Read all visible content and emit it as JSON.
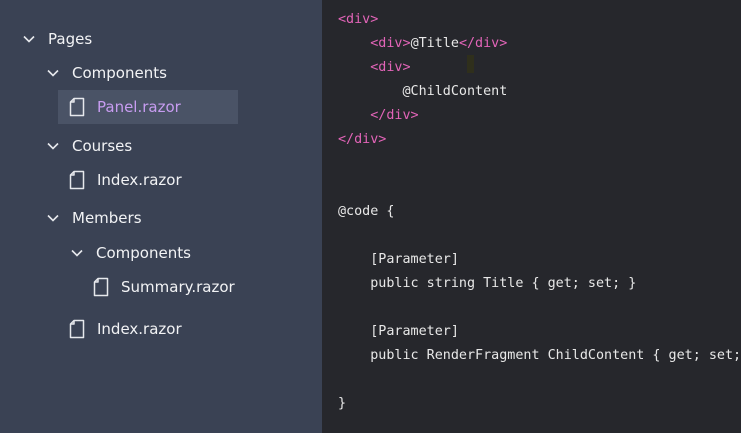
{
  "explorer": {
    "items": [
      {
        "label": "Pages",
        "kind": "folder",
        "expanded": true,
        "depth": 0
      },
      {
        "label": "Components",
        "kind": "folder",
        "expanded": true,
        "depth": 1
      },
      {
        "label": "Panel.razor",
        "kind": "file",
        "depth": 2,
        "selected": true
      },
      {
        "label": "Courses",
        "kind": "folder",
        "expanded": true,
        "depth": 1
      },
      {
        "label": "Index.razor",
        "kind": "file",
        "depth": 2
      },
      {
        "label": "Members",
        "kind": "folder",
        "expanded": true,
        "depth": 1
      },
      {
        "label": "Components",
        "kind": "folder",
        "expanded": true,
        "depth": 2
      },
      {
        "label": "Summary.razor",
        "kind": "file",
        "depth": 3
      },
      {
        "label": "Index.razor",
        "kind": "file",
        "depth": 2
      }
    ]
  },
  "editor": {
    "lines": [
      [
        {
          "t": "<div>",
          "c": "tag"
        }
      ],
      [
        {
          "t": "    ",
          "c": "plain"
        },
        {
          "t": "<div>",
          "c": "tag"
        },
        {
          "t": "@Title",
          "c": "plain"
        },
        {
          "t": "</div>",
          "c": "tag"
        }
      ],
      [
        {
          "t": "    ",
          "c": "plain"
        },
        {
          "t": "<div>",
          "c": "tag"
        }
      ],
      [
        {
          "t": "        @ChildContent",
          "c": "plain"
        }
      ],
      [
        {
          "t": "    ",
          "c": "plain"
        },
        {
          "t": "</div>",
          "c": "tag"
        }
      ],
      [
        {
          "t": "</div>",
          "c": "tag"
        }
      ],
      [],
      [],
      [
        {
          "t": "@code {",
          "c": "plain"
        }
      ],
      [],
      [
        {
          "t": "    [Parameter]",
          "c": "plain"
        }
      ],
      [
        {
          "t": "    public string Title { get; set; }",
          "c": "plain"
        }
      ],
      [],
      [
        {
          "t": "    [Parameter]",
          "c": "plain"
        }
      ],
      [
        {
          "t": "    public RenderFragment ChildContent { get; set; }",
          "c": "plain"
        }
      ],
      [],
      [
        {
          "t": "}",
          "c": "plain"
        }
      ]
    ]
  },
  "colors": {
    "sidebar_bg": "#3a4254",
    "editor_bg": "#26272c",
    "selected_bg": "#4a5366",
    "selected_text": "#c79cf0",
    "tag": "#e264b8"
  },
  "icons": {
    "folder_toggle": "chevron-down-icon",
    "file": "file-icon"
  }
}
